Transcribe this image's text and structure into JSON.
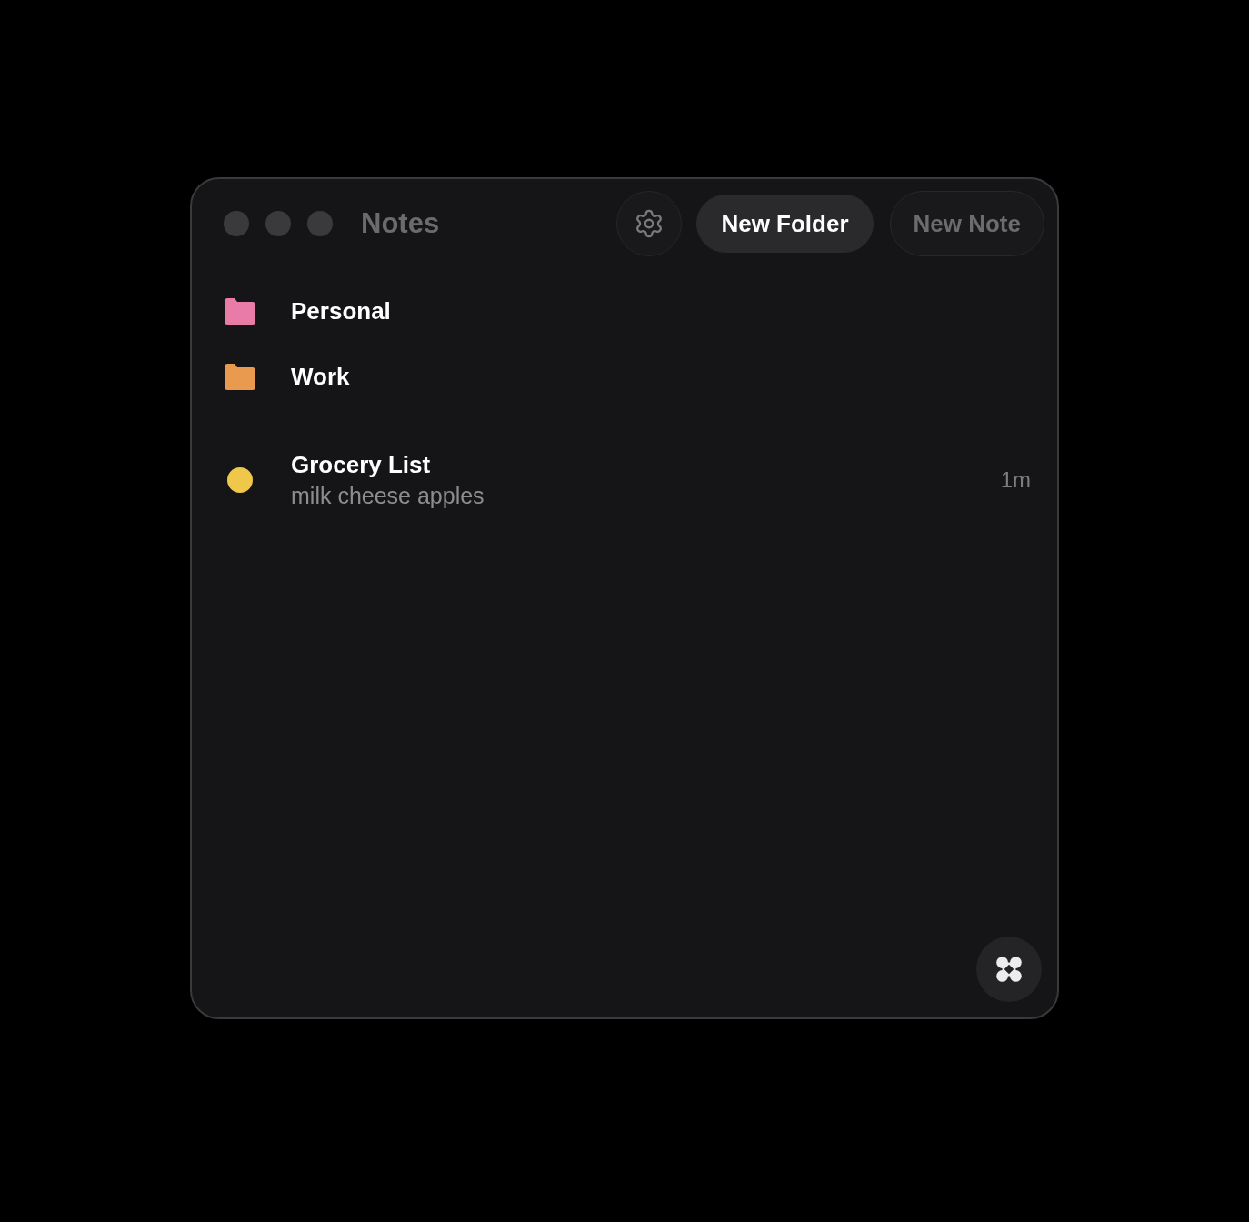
{
  "window": {
    "title": "Notes"
  },
  "toolbar": {
    "buttons": [
      {
        "label": "New Folder",
        "disabled": false
      },
      {
        "label": "New Note",
        "disabled": true
      }
    ]
  },
  "folders": [
    {
      "name": "Personal",
      "color": "#e87ba8"
    },
    {
      "name": "Work",
      "color": "#e99a4f"
    }
  ],
  "notes": [
    {
      "title": "Grocery List",
      "preview": "milk cheese apples",
      "time": "1m",
      "color": "#efc84b"
    }
  ]
}
